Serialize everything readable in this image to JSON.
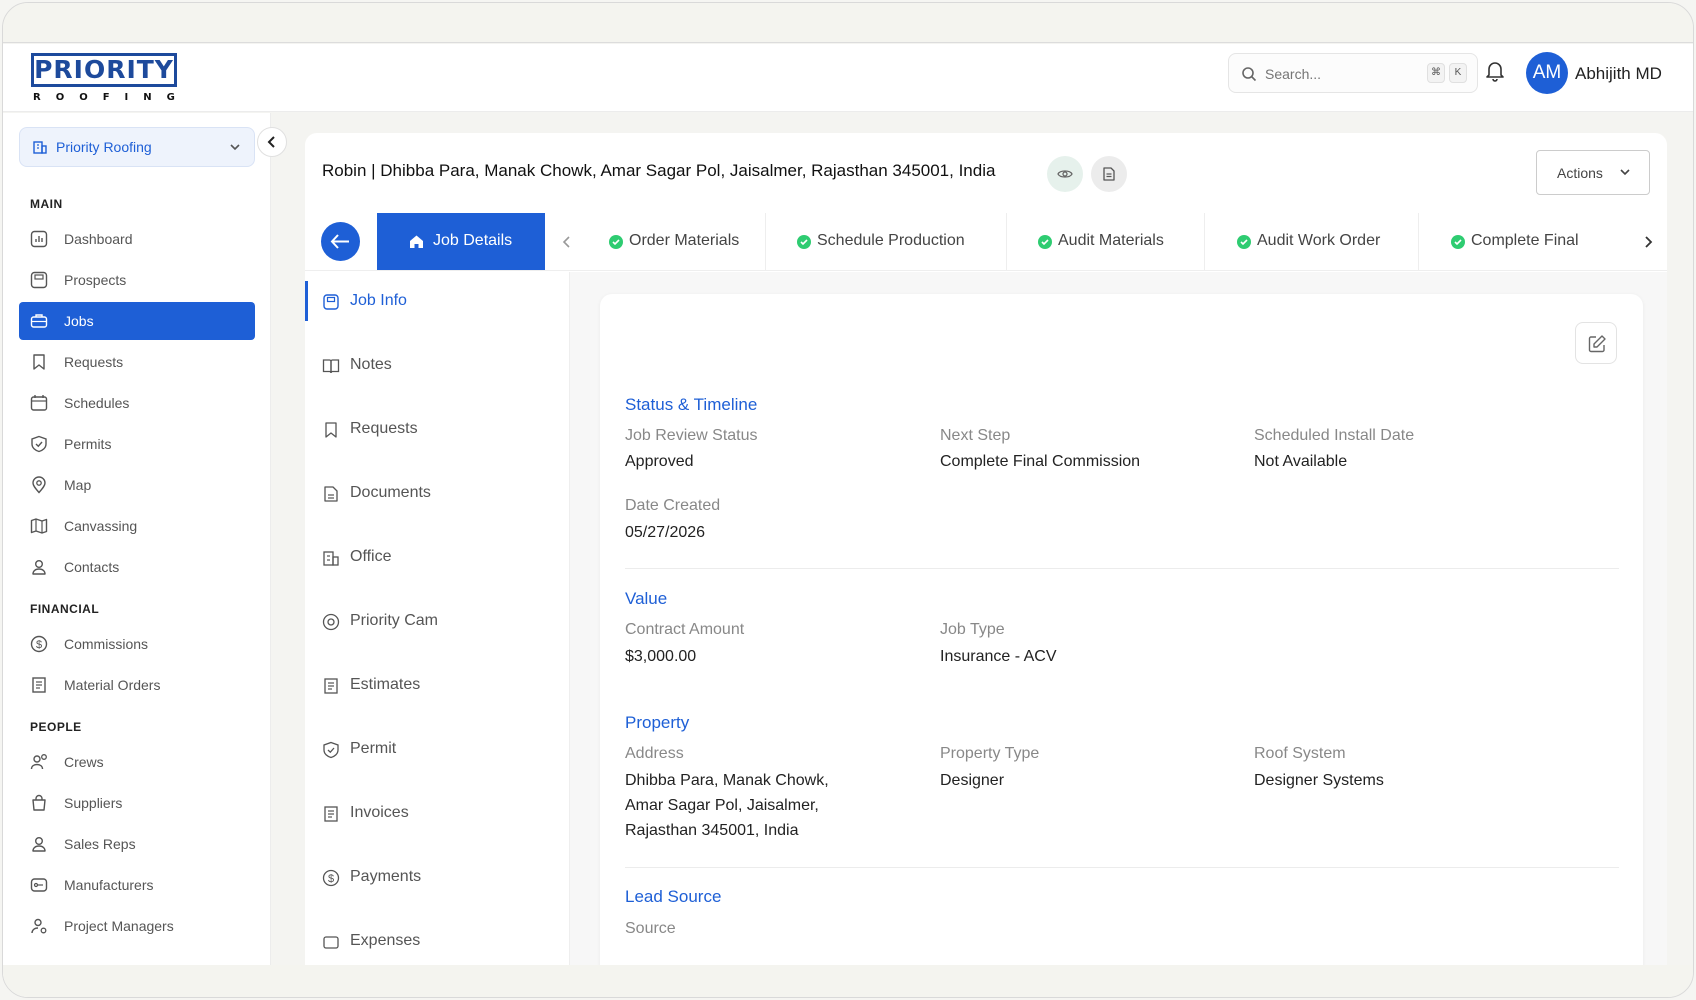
{
  "header": {
    "logo_main": "PRIORITY",
    "logo_sub": "ROOFING",
    "search_placeholder": "Search...",
    "kbd_cmd": "⌘",
    "kbd_k": "K",
    "avatar_initials": "AM",
    "user_name": "Abhijith MD"
  },
  "sidebar": {
    "org_name": "Priority Roofing",
    "sections": {
      "main": "MAIN",
      "financial": "FINANCIAL",
      "people": "PEOPLE"
    },
    "items": {
      "dashboard": "Dashboard",
      "prospects": "Prospects",
      "jobs": "Jobs",
      "requests": "Requests",
      "schedules": "Schedules",
      "permits": "Permits",
      "map": "Map",
      "canvassing": "Canvassing",
      "contacts": "Contacts",
      "commissions": "Commissions",
      "material_orders": "Material Orders",
      "crews": "Crews",
      "suppliers": "Suppliers",
      "sales_reps": "Sales Reps",
      "manufacturers": "Manufacturers",
      "project_managers": "Project Managers"
    },
    "active": "jobs"
  },
  "job": {
    "title": "Robin | Dhibba Para, Manak Chowk, Amar Sagar Pol, Jaisalmer, Rajasthan 345001, India",
    "actions_label": "Actions"
  },
  "steps": {
    "active": "Job Details",
    "list": [
      "Order Materials",
      "Schedule Production",
      "Audit Materials",
      "Audit Work Order",
      "Complete Final"
    ]
  },
  "submenu": {
    "job_info": "Job Info",
    "notes": "Notes",
    "requests": "Requests",
    "documents": "Documents",
    "office": "Office",
    "priority_cam": "Priority Cam",
    "estimates": "Estimates",
    "permit": "Permit",
    "invoices": "Invoices",
    "payments": "Payments",
    "expenses": "Expenses"
  },
  "details": {
    "status_timeline": {
      "heading": "Status & Timeline",
      "job_review_status_label": "Job Review Status",
      "job_review_status": "Approved",
      "next_step_label": "Next Step",
      "next_step": "Complete Final Commission",
      "scheduled_install_label": "Scheduled Install Date",
      "scheduled_install": "Not Available",
      "date_created_label": "Date Created",
      "date_created": "05/27/2026"
    },
    "value": {
      "heading": "Value",
      "contract_amount_label": "Contract Amount",
      "contract_amount": "$3,000.00",
      "job_type_label": "Job Type",
      "job_type": "Insurance - ACV"
    },
    "property": {
      "heading": "Property",
      "address_label": "Address",
      "address_line1": "Dhibba Para, Manak Chowk,",
      "address_line2": "Amar Sagar Pol, Jaisalmer,",
      "address_line3": "Rajasthan 345001, India",
      "property_type_label": "Property Type",
      "property_type": "Designer",
      "roof_system_label": "Roof System",
      "roof_system": "Designer Systems"
    },
    "lead_source": {
      "heading": "Lead Source",
      "source_label": "Source"
    }
  },
  "colors": {
    "accent": "#1e5fd6",
    "success": "#2ecc71"
  }
}
